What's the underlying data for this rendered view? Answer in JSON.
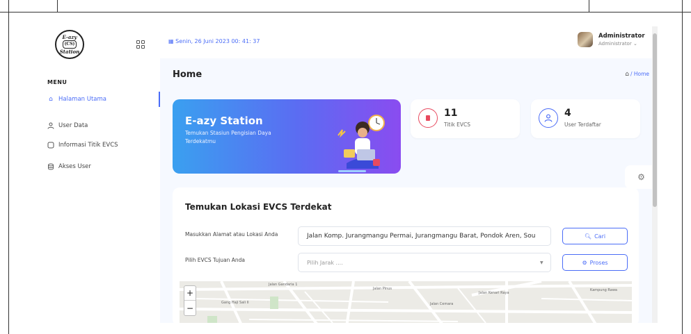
{
  "app": {
    "logo_text_top": "E-azy",
    "logo_text_bottom": "Station",
    "logo_plug": "(CS)"
  },
  "sidebar": {
    "menu_title": "MENU",
    "items": [
      {
        "label": "Halaman Utama",
        "icon": "home-icon",
        "active": true
      },
      {
        "label": "User Data",
        "icon": "user-icon",
        "active": false
      },
      {
        "label": "Informasi Titik EVCS",
        "icon": "info-icon",
        "active": false
      },
      {
        "label": "Akses User",
        "icon": "database-icon",
        "active": false
      }
    ]
  },
  "topbar": {
    "date": "Senin, 26 Juni 2023  00: 41: 37",
    "user_name": "Administrator",
    "user_role": "Administrator ⌄"
  },
  "page": {
    "title": "Home",
    "breadcrumb": "/ Home"
  },
  "banner": {
    "title": "E-azy Station",
    "subtitle": "Temukan Stasiun Pengisian Daya Terdekatmu"
  },
  "stats": [
    {
      "value": "11",
      "label": "Titik EVCS",
      "icon": "book-icon",
      "color": "#e84a5f"
    },
    {
      "value": "4",
      "label": "User Terdaftar",
      "icon": "user-icon",
      "color": "#4a6cf7"
    }
  ],
  "finder": {
    "title": "Temukan Lokasi EVCS Terdekat",
    "address_label": "Masukkan Alamat atau Lokasi Anda",
    "address_value": "Jalan Komp. Jurangmangu Permai, Jurangmangu Barat, Pondok Aren, Sou",
    "station_label": "Pilih EVCS Tujuan Anda",
    "station_placeholder": "Pilih Jarak ....",
    "search_button": "Cari",
    "process_button": "Proses"
  },
  "map": {
    "zoom_in": "+",
    "zoom_out": "−",
    "labels": [
      "Jalan Gandaria 1",
      "Gang Haji Sali II",
      "Jalan Kenari Raya",
      "Jalan Pinus",
      "Jalan Cemara",
      "Kampung Rawa"
    ]
  },
  "colors": {
    "accent": "#4a6cf7",
    "danger": "#e84a5f"
  }
}
